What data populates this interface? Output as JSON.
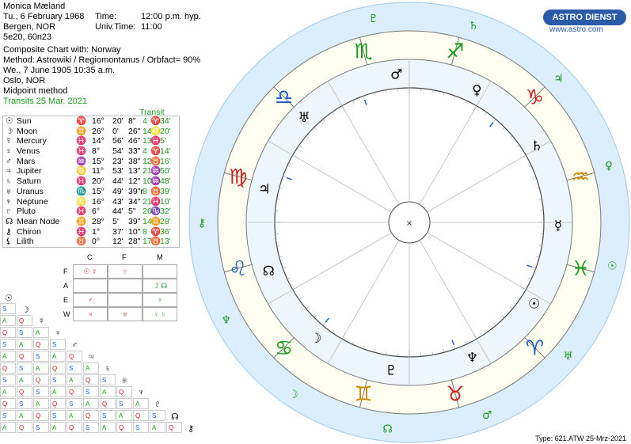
{
  "header": {
    "name": "Monica Mæland",
    "date_line": "Tu., 6 February 1968",
    "time_label": "Time:",
    "time_value": "12:00 p.m. hyp.",
    "place": "Bergen, NOR",
    "univ_label": "Univ.Time:",
    "univ_value": "11:00",
    "coords": "5e20, 60n23",
    "composite_line": "Composite Chart with:  Norway",
    "method_line": "Method: Astrowiki / Regiomontanus / Orbfact= 90%",
    "date2_line": "We., 7 June 1905   10:35 a.m.",
    "place2": "Oslo, NOR",
    "midpoint": "Midpoint method",
    "transits": "Transits 25 Mar. 2021"
  },
  "logo": {
    "brand": "ASTRO DIENST",
    "url": "www.astro.com"
  },
  "positions": {
    "transit_label": "Transit",
    "rows": [
      {
        "glyph": "☉",
        "name": "Sun",
        "sign": "♈",
        "deg": "16°",
        "min": "20'",
        "sec": "8\"",
        "tdeg": "4",
        "tsign": "♈",
        "tmin": "34'"
      },
      {
        "glyph": "☽",
        "name": "Moon",
        "sign": "♊",
        "deg": "26°",
        "min": "0'",
        "sec": "26\"",
        "tdeg": "14",
        "tsign": "♌",
        "tmin": "20'"
      },
      {
        "glyph": "☿",
        "name": "Mercury",
        "sign": "♓",
        "deg": "14°",
        "min": "56'",
        "sec": "46\"",
        "tdeg": "13",
        "tsign": "♓",
        "tmin": "5'"
      },
      {
        "glyph": "♀",
        "name": "Venus",
        "sign": "♓",
        "deg": "8°",
        "min": "54'",
        "sec": "33\"",
        "tdeg": "4",
        "tsign": "♈",
        "tmin": "14'"
      },
      {
        "glyph": "♂",
        "name": "Mars",
        "sign": "♒",
        "deg": "15°",
        "min": "23'",
        "sec": "38\"",
        "tdeg": "12",
        "tsign": "♉",
        "tmin": "16'"
      },
      {
        "glyph": "♃",
        "name": "Jupiter",
        "sign": "♋",
        "deg": "11°",
        "min": "53'",
        "sec": "13\"",
        "tdeg": "21",
        "tsign": "♒",
        "tmin": "50'"
      },
      {
        "glyph": "♄",
        "name": "Saturn",
        "sign": "♓",
        "deg": "20°",
        "min": "44'",
        "sec": "12\"",
        "tdeg": "10",
        "tsign": "♒",
        "tmin": "48'"
      },
      {
        "glyph": "♅",
        "name": "Uranus",
        "sign": "♏",
        "deg": "15°",
        "min": "49'",
        "sec": "39\"r",
        "tdeg": "8",
        "tsign": "♉",
        "tmin": "39'"
      },
      {
        "glyph": "♆",
        "name": "Neptune",
        "sign": "♌",
        "deg": "16°",
        "min": "43'",
        "sec": "34\"",
        "tdeg": "21",
        "tsign": "♓",
        "tmin": "10'"
      },
      {
        "glyph": "♇",
        "name": "Pluto",
        "sign": "♓",
        "deg": "6°",
        "min": "44'",
        "sec": "5\"",
        "tdeg": "26",
        "tsign": "♑",
        "tmin": "32'"
      },
      {
        "glyph": "☊",
        "name": "Mean Node",
        "sign": "♊",
        "deg": "28°",
        "min": "5'",
        "sec": "39\"",
        "tdeg": "14",
        "tsign": "♊",
        "tmin": "28'"
      },
      {
        "glyph": "⚷",
        "name": "Chiron",
        "sign": "♓",
        "deg": "1°",
        "min": "37'",
        "sec": "10\"",
        "tdeg": "8",
        "tsign": "♈",
        "tmin": "36'"
      },
      {
        "glyph": "⚸",
        "name": "Lilith",
        "sign": "♉",
        "deg": "0°",
        "min": "12'",
        "sec": "28\"",
        "tdeg": "17",
        "tsign": "♉",
        "tmin": "13'"
      }
    ]
  },
  "modality_grid": {
    "cols": [
      "C",
      "F",
      "M"
    ],
    "rows": [
      {
        "label": "F",
        "c": "☉ ☿",
        "f": "♇",
        "m": ""
      },
      {
        "label": "A",
        "c": "",
        "f": "",
        "m": "☽ ☊"
      },
      {
        "label": "E",
        "c": "♂",
        "f": "",
        "m": "♆"
      },
      {
        "label": "W",
        "c": "♃",
        "f": "♅",
        "m": "♀ ♄"
      }
    ]
  },
  "aspect_glyphs": [
    "☉",
    "☽",
    "☿",
    "♀",
    "♂",
    "♃",
    "♄",
    "♅",
    "♆",
    "♇",
    "☊",
    "⚷"
  ],
  "aspect_labels": [
    "Q",
    "S",
    "A",
    "Q",
    "S",
    "A"
  ],
  "wheel": {
    "center_mark": "×",
    "outer_signs": [
      {
        "g": "♐",
        "color": "#1a9b1a"
      },
      {
        "g": "♑",
        "color": "#cc2222"
      },
      {
        "g": "♒",
        "color": "#cc8800"
      },
      {
        "g": "♓",
        "color": "#1a9b1a"
      },
      {
        "g": "♈",
        "color": "#1f5fc8"
      },
      {
        "g": "♉",
        "color": "#cc2222"
      },
      {
        "g": "♊",
        "color": "#cc8800"
      },
      {
        "g": "♋",
        "color": "#1a9b1a"
      },
      {
        "g": "♌",
        "color": "#1f5fc8"
      },
      {
        "g": "♍",
        "color": "#cc2222"
      },
      {
        "g": "♎",
        "color": "#1f5fc8"
      },
      {
        "g": "♏",
        "color": "#1a9b1a"
      }
    ],
    "transit_planets": [
      {
        "g": "♇",
        "color": "#1a9b1a"
      },
      {
        "g": "♄",
        "color": "#1a9b1a"
      },
      {
        "g": "♃",
        "color": "#1a9b1a"
      },
      {
        "g": "♀",
        "color": "#1a9b1a"
      },
      {
        "g": "☉",
        "color": "#1a9b1a"
      },
      {
        "g": "♅",
        "color": "#1a9b1a"
      },
      {
        "g": "♂",
        "color": "#1a9b1a"
      },
      {
        "g": "☊",
        "color": "#1a9b1a"
      },
      {
        "g": "☽",
        "color": "#1a9b1a"
      },
      {
        "g": "♆",
        "color": "#1a9b1a"
      },
      {
        "g": "⚷",
        "color": "#1a9b1a"
      }
    ],
    "radix_planets": [
      {
        "g": "♂",
        "color": "#000"
      },
      {
        "g": "♀",
        "color": "#000"
      },
      {
        "g": "♄",
        "color": "#000"
      },
      {
        "g": "☿",
        "color": "#000"
      },
      {
        "g": "☉",
        "color": "#000"
      },
      {
        "g": "♆",
        "color": "#000"
      },
      {
        "g": "♇",
        "color": "#000"
      },
      {
        "g": "☽",
        "color": "#000"
      },
      {
        "g": "☊",
        "color": "#000"
      },
      {
        "g": "♃",
        "color": "#000"
      },
      {
        "g": "♅",
        "color": "#000"
      }
    ]
  },
  "footer": "Type: 621.ATW  25-Mrz-2021"
}
